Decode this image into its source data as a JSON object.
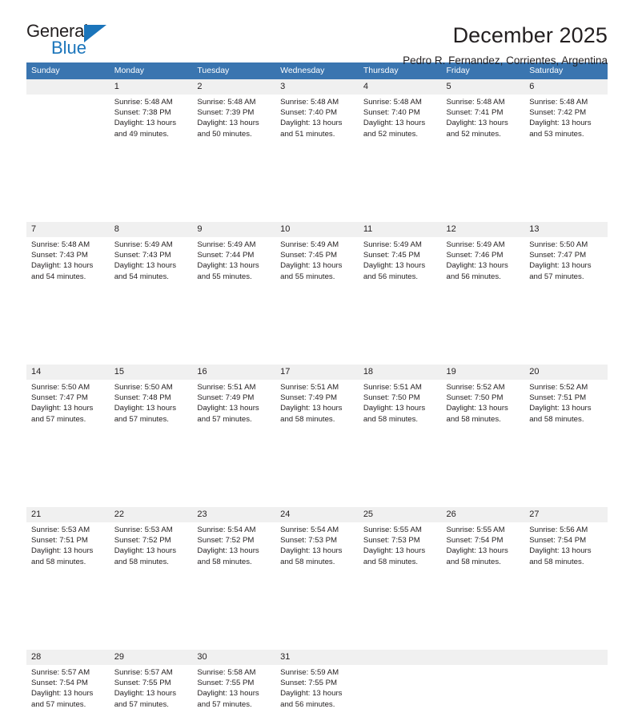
{
  "brand": {
    "name_part1": "General",
    "name_part2": "Blue",
    "accent_color": "#1b75bb"
  },
  "header": {
    "title": "December 2025",
    "subtitle": "Pedro R. Fernandez, Corrientes, Argentina"
  },
  "theme": {
    "header_row_bg": "#3a75b0",
    "daynum_bg": "#f0f0f0",
    "text_color": "#231f20"
  },
  "weekdays": [
    "Sunday",
    "Monday",
    "Tuesday",
    "Wednesday",
    "Thursday",
    "Friday",
    "Saturday"
  ],
  "labels": {
    "sunrise_prefix": "Sunrise:",
    "sunset_prefix": "Sunset:",
    "daylight_prefix": "Daylight:"
  },
  "weeks": [
    [
      {
        "day": "",
        "empty": true
      },
      {
        "day": "1",
        "sunrise": "Sunrise: 5:48 AM",
        "sunset": "Sunset: 7:38 PM",
        "daylight": "Daylight: 13 hours and 49 minutes."
      },
      {
        "day": "2",
        "sunrise": "Sunrise: 5:48 AM",
        "sunset": "Sunset: 7:39 PM",
        "daylight": "Daylight: 13 hours and 50 minutes."
      },
      {
        "day": "3",
        "sunrise": "Sunrise: 5:48 AM",
        "sunset": "Sunset: 7:40 PM",
        "daylight": "Daylight: 13 hours and 51 minutes."
      },
      {
        "day": "4",
        "sunrise": "Sunrise: 5:48 AM",
        "sunset": "Sunset: 7:40 PM",
        "daylight": "Daylight: 13 hours and 52 minutes."
      },
      {
        "day": "5",
        "sunrise": "Sunrise: 5:48 AM",
        "sunset": "Sunset: 7:41 PM",
        "daylight": "Daylight: 13 hours and 52 minutes."
      },
      {
        "day": "6",
        "sunrise": "Sunrise: 5:48 AM",
        "sunset": "Sunset: 7:42 PM",
        "daylight": "Daylight: 13 hours and 53 minutes."
      }
    ],
    [
      {
        "day": "7",
        "sunrise": "Sunrise: 5:48 AM",
        "sunset": "Sunset: 7:43 PM",
        "daylight": "Daylight: 13 hours and 54 minutes."
      },
      {
        "day": "8",
        "sunrise": "Sunrise: 5:49 AM",
        "sunset": "Sunset: 7:43 PM",
        "daylight": "Daylight: 13 hours and 54 minutes."
      },
      {
        "day": "9",
        "sunrise": "Sunrise: 5:49 AM",
        "sunset": "Sunset: 7:44 PM",
        "daylight": "Daylight: 13 hours and 55 minutes."
      },
      {
        "day": "10",
        "sunrise": "Sunrise: 5:49 AM",
        "sunset": "Sunset: 7:45 PM",
        "daylight": "Daylight: 13 hours and 55 minutes."
      },
      {
        "day": "11",
        "sunrise": "Sunrise: 5:49 AM",
        "sunset": "Sunset: 7:45 PM",
        "daylight": "Daylight: 13 hours and 56 minutes."
      },
      {
        "day": "12",
        "sunrise": "Sunrise: 5:49 AM",
        "sunset": "Sunset: 7:46 PM",
        "daylight": "Daylight: 13 hours and 56 minutes."
      },
      {
        "day": "13",
        "sunrise": "Sunrise: 5:50 AM",
        "sunset": "Sunset: 7:47 PM",
        "daylight": "Daylight: 13 hours and 57 minutes."
      }
    ],
    [
      {
        "day": "14",
        "sunrise": "Sunrise: 5:50 AM",
        "sunset": "Sunset: 7:47 PM",
        "daylight": "Daylight: 13 hours and 57 minutes."
      },
      {
        "day": "15",
        "sunrise": "Sunrise: 5:50 AM",
        "sunset": "Sunset: 7:48 PM",
        "daylight": "Daylight: 13 hours and 57 minutes."
      },
      {
        "day": "16",
        "sunrise": "Sunrise: 5:51 AM",
        "sunset": "Sunset: 7:49 PM",
        "daylight": "Daylight: 13 hours and 57 minutes."
      },
      {
        "day": "17",
        "sunrise": "Sunrise: 5:51 AM",
        "sunset": "Sunset: 7:49 PM",
        "daylight": "Daylight: 13 hours and 58 minutes."
      },
      {
        "day": "18",
        "sunrise": "Sunrise: 5:51 AM",
        "sunset": "Sunset: 7:50 PM",
        "daylight": "Daylight: 13 hours and 58 minutes."
      },
      {
        "day": "19",
        "sunrise": "Sunrise: 5:52 AM",
        "sunset": "Sunset: 7:50 PM",
        "daylight": "Daylight: 13 hours and 58 minutes."
      },
      {
        "day": "20",
        "sunrise": "Sunrise: 5:52 AM",
        "sunset": "Sunset: 7:51 PM",
        "daylight": "Daylight: 13 hours and 58 minutes."
      }
    ],
    [
      {
        "day": "21",
        "sunrise": "Sunrise: 5:53 AM",
        "sunset": "Sunset: 7:51 PM",
        "daylight": "Daylight: 13 hours and 58 minutes."
      },
      {
        "day": "22",
        "sunrise": "Sunrise: 5:53 AM",
        "sunset": "Sunset: 7:52 PM",
        "daylight": "Daylight: 13 hours and 58 minutes."
      },
      {
        "day": "23",
        "sunrise": "Sunrise: 5:54 AM",
        "sunset": "Sunset: 7:52 PM",
        "daylight": "Daylight: 13 hours and 58 minutes."
      },
      {
        "day": "24",
        "sunrise": "Sunrise: 5:54 AM",
        "sunset": "Sunset: 7:53 PM",
        "daylight": "Daylight: 13 hours and 58 minutes."
      },
      {
        "day": "25",
        "sunrise": "Sunrise: 5:55 AM",
        "sunset": "Sunset: 7:53 PM",
        "daylight": "Daylight: 13 hours and 58 minutes."
      },
      {
        "day": "26",
        "sunrise": "Sunrise: 5:55 AM",
        "sunset": "Sunset: 7:54 PM",
        "daylight": "Daylight: 13 hours and 58 minutes."
      },
      {
        "day": "27",
        "sunrise": "Sunrise: 5:56 AM",
        "sunset": "Sunset: 7:54 PM",
        "daylight": "Daylight: 13 hours and 58 minutes."
      }
    ],
    [
      {
        "day": "28",
        "sunrise": "Sunrise: 5:57 AM",
        "sunset": "Sunset: 7:54 PM",
        "daylight": "Daylight: 13 hours and 57 minutes."
      },
      {
        "day": "29",
        "sunrise": "Sunrise: 5:57 AM",
        "sunset": "Sunset: 7:55 PM",
        "daylight": "Daylight: 13 hours and 57 minutes."
      },
      {
        "day": "30",
        "sunrise": "Sunrise: 5:58 AM",
        "sunset": "Sunset: 7:55 PM",
        "daylight": "Daylight: 13 hours and 57 minutes."
      },
      {
        "day": "31",
        "sunrise": "Sunrise: 5:59 AM",
        "sunset": "Sunset: 7:55 PM",
        "daylight": "Daylight: 13 hours and 56 minutes."
      },
      {
        "day": "",
        "empty": true
      },
      {
        "day": "",
        "empty": true
      },
      {
        "day": "",
        "empty": true
      }
    ]
  ]
}
